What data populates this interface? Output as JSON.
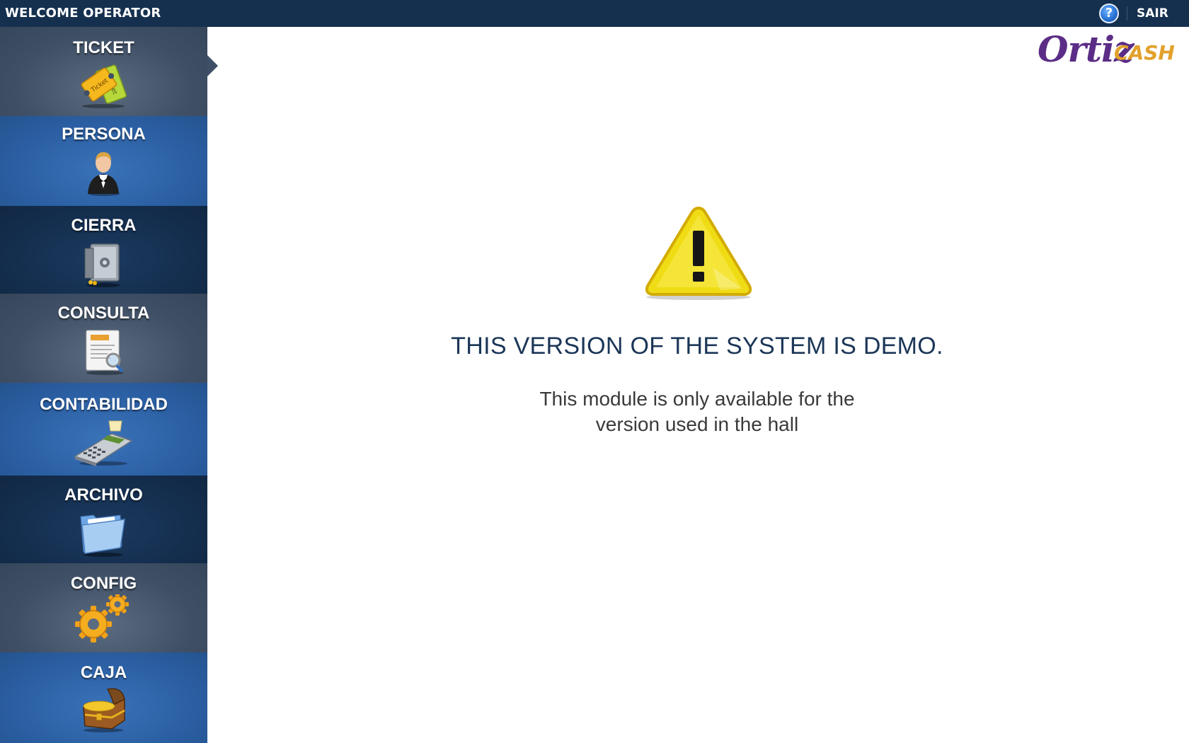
{
  "header": {
    "welcome_text": "WELCOME OPERATOR",
    "help_icon": "help-icon",
    "help_glyph": "?",
    "logout_label": "SAIR"
  },
  "logo": {
    "part1": "Ortiz",
    "part2": "CASH",
    "colors": {
      "ortiz": "#5b2d86",
      "cash": "#e2a12b"
    }
  },
  "sidebar": {
    "active_index": 0,
    "items": [
      {
        "label": "TICKET",
        "icon": "ticket-icon",
        "shade": "gray"
      },
      {
        "label": "PERSONA",
        "icon": "person-icon",
        "shade": "blue"
      },
      {
        "label": "CIERRA",
        "icon": "safe-icon",
        "shade": "navy"
      },
      {
        "label": "CONSULTA",
        "icon": "document-search-icon",
        "shade": "gray"
      },
      {
        "label": "CONTABILIDAD",
        "icon": "cash-register-icon",
        "shade": "blue"
      },
      {
        "label": "ARCHIVO",
        "icon": "folder-icon",
        "shade": "navy"
      },
      {
        "label": "CONFIG",
        "icon": "gears-icon",
        "shade": "gray"
      },
      {
        "label": "CAJA",
        "icon": "treasure-chest-icon",
        "shade": "blue"
      }
    ]
  },
  "main": {
    "warning_icon": "warning-icon",
    "title": "THIS VERSION OF THE SYSTEM IS DEMO.",
    "message_line1": "This module is only available for the",
    "message_line2": "version used in the hall"
  },
  "colors": {
    "topbar": "#15304f",
    "sidebar_gray": "#3f4f65",
    "sidebar_blue": "#2b5fa3",
    "sidebar_navy": "#142e4e",
    "title_text": "#1b3657",
    "warning_yellow": "#f3e11a"
  }
}
